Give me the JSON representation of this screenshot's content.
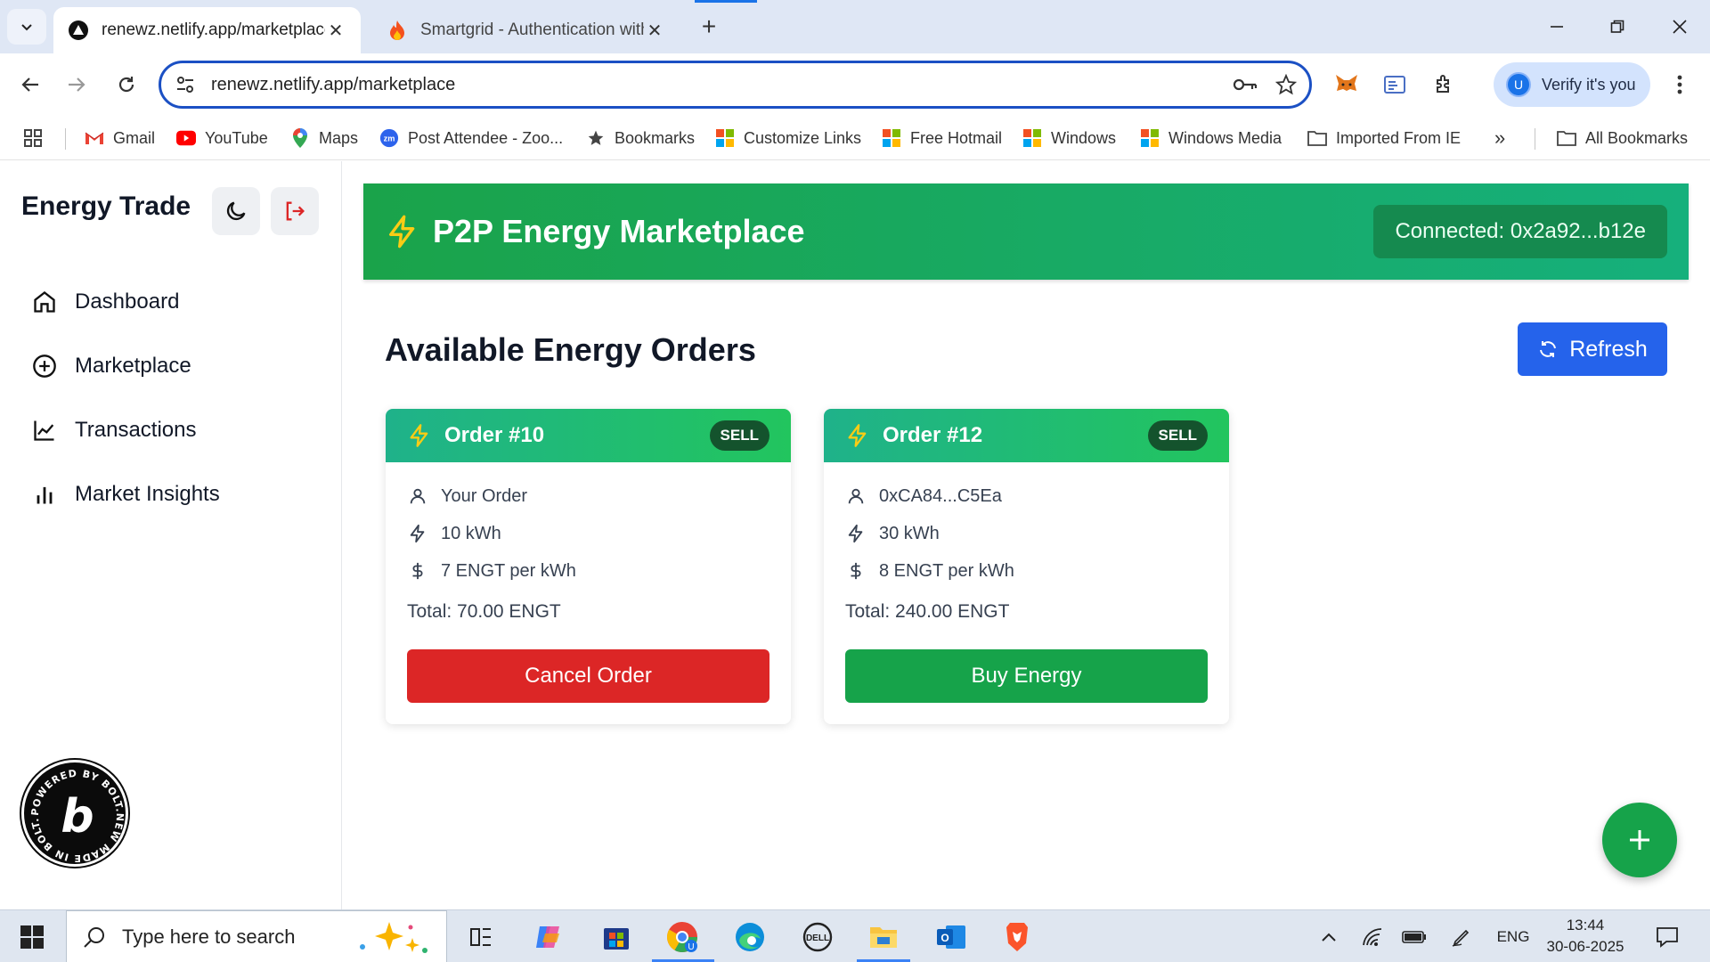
{
  "browser": {
    "tabs": [
      {
        "title": "renewz.netlify.app/marketplace",
        "active": true
      },
      {
        "title": "Smartgrid - Authentication with",
        "active": false
      }
    ],
    "address": "renewz.netlify.app/marketplace",
    "profile_label": "Verify it's you",
    "profile_initial": "U"
  },
  "bookmarks": [
    {
      "label": "Gmail",
      "icon": "gmail-icon"
    },
    {
      "label": "YouTube",
      "icon": "youtube-icon"
    },
    {
      "label": "Maps",
      "icon": "maps-icon"
    },
    {
      "label": "Post Attendee - Zoo...",
      "icon": "zoom-icon"
    },
    {
      "label": "Bookmarks",
      "icon": "star-icon"
    },
    {
      "label": "Customize Links",
      "icon": "windows-icon"
    },
    {
      "label": "Free Hotmail",
      "icon": "windows-icon"
    },
    {
      "label": "Windows",
      "icon": "windows-icon"
    },
    {
      "label": "Windows Media",
      "icon": "windows-icon"
    },
    {
      "label": "Imported From IE",
      "icon": "folder-icon"
    },
    {
      "label": "All Bookmarks",
      "icon": "folder-icon"
    }
  ],
  "sidebar": {
    "brand": "Energy Trade",
    "items": [
      {
        "label": "Dashboard",
        "icon": "home-icon"
      },
      {
        "label": "Marketplace",
        "icon": "plus-circle-icon"
      },
      {
        "label": "Transactions",
        "icon": "line-chart-icon"
      },
      {
        "label": "Market Insights",
        "icon": "bar-chart-icon"
      }
    ],
    "badge_text": "POWERED BY BOLT.NEW MADE IN BOLT.NEW",
    "badge_letter": "b"
  },
  "header": {
    "title": "P2P Energy Marketplace",
    "connection": "Connected: 0x2a92...b12e"
  },
  "main": {
    "section_title": "Available Energy Orders",
    "refresh_label": "Refresh",
    "orders": [
      {
        "title": "Order #10",
        "type": "SELL",
        "owner": "Your Order",
        "amount": "10 kWh",
        "price": "7 ENGT per kWh",
        "total": "Total: 70.00 ENGT",
        "action": "Cancel Order"
      },
      {
        "title": "Order #12",
        "type": "SELL",
        "owner": "0xCA84...C5Ea",
        "amount": "30 kWh",
        "price": "8 ENGT per kWh",
        "total": "Total: 240.00 ENGT",
        "action": "Buy Energy"
      }
    ]
  },
  "taskbar": {
    "search_placeholder": "Type here to search",
    "language": "ENG",
    "time": "13:44",
    "date": "30-06-2025"
  },
  "colors": {
    "header_green": "#1aa34a",
    "cancel_red": "#dc2626",
    "buy_green": "#16a34a",
    "refresh_blue": "#2563eb"
  }
}
